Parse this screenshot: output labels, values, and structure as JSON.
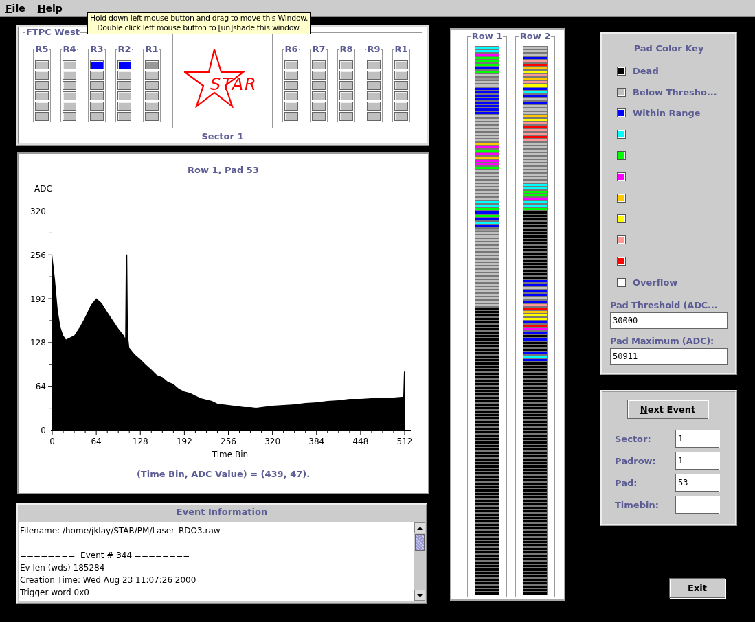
{
  "menu": [
    {
      "label": "File",
      "underline_first": true
    },
    {
      "label": "Help",
      "underline_first": true
    }
  ],
  "tooltip": {
    "lines": [
      "Hold down left mouse button and drag to move this Window.",
      "Double click left mouse button to [un]shade this window."
    ]
  },
  "sector_panel": {
    "groups": [
      {
        "title": "FTPC West",
        "rows": [
          {
            "label": "R5",
            "pads": [
              {
                "color": "#c0c0c0"
              },
              {
                "color": "#c0c0c0"
              },
              {
                "color": "#c0c0c0"
              },
              {
                "color": "#c0c0c0"
              },
              {
                "color": "#c0c0c0"
              },
              {
                "color": "#c0c0c0"
              }
            ]
          },
          {
            "label": "R4",
            "pads": [
              {
                "color": "#c0c0c0"
              },
              {
                "color": "#c0c0c0"
              },
              {
                "color": "#c0c0c0"
              },
              {
                "color": "#c0c0c0"
              },
              {
                "color": "#c0c0c0"
              },
              {
                "color": "#c0c0c0"
              }
            ]
          },
          {
            "label": "R3",
            "pads": [
              {
                "color": "#0000ff"
              },
              {
                "color": "#c0c0c0"
              },
              {
                "color": "#c0c0c0"
              },
              {
                "color": "#c0c0c0"
              },
              {
                "color": "#c0c0c0"
              },
              {
                "color": "#c0c0c0"
              }
            ]
          },
          {
            "label": "R2",
            "pads": [
              {
                "color": "#0000ff"
              },
              {
                "color": "#c0c0c0"
              },
              {
                "color": "#c0c0c0"
              },
              {
                "color": "#c0c0c0"
              },
              {
                "color": "#c0c0c0"
              },
              {
                "color": "#c0c0c0"
              }
            ]
          },
          {
            "label": "R1",
            "pads": [
              {
                "color": "#999999"
              },
              {
                "color": "#c0c0c0"
              },
              {
                "color": "#c0c0c0"
              },
              {
                "color": "#c0c0c0"
              },
              {
                "color": "#c0c0c0"
              },
              {
                "color": "#c0c0c0"
              }
            ]
          }
        ]
      },
      {
        "rows": [
          {
            "label": "R6",
            "pads": [
              {
                "color": "#c0c0c0"
              },
              {
                "color": "#c0c0c0"
              },
              {
                "color": "#c0c0c0"
              },
              {
                "color": "#c0c0c0"
              },
              {
                "color": "#c0c0c0"
              },
              {
                "color": "#c0c0c0"
              }
            ]
          },
          {
            "label": "R7",
            "pads": [
              {
                "color": "#c0c0c0"
              },
              {
                "color": "#c0c0c0"
              },
              {
                "color": "#c0c0c0"
              },
              {
                "color": "#c0c0c0"
              },
              {
                "color": "#c0c0c0"
              },
              {
                "color": "#c0c0c0"
              }
            ]
          },
          {
            "label": "R8",
            "pads": [
              {
                "color": "#c0c0c0"
              },
              {
                "color": "#c0c0c0"
              },
              {
                "color": "#c0c0c0"
              },
              {
                "color": "#c0c0c0"
              },
              {
                "color": "#c0c0c0"
              },
              {
                "color": "#c0c0c0"
              }
            ]
          },
          {
            "label": "R9",
            "pads": [
              {
                "color": "#c0c0c0"
              },
              {
                "color": "#c0c0c0"
              },
              {
                "color": "#c0c0c0"
              },
              {
                "color": "#c0c0c0"
              },
              {
                "color": "#c0c0c0"
              },
              {
                "color": "#c0c0c0"
              }
            ]
          },
          {
            "label": "R1",
            "pads": [
              {
                "color": "#c0c0c0"
              },
              {
                "color": "#c0c0c0"
              },
              {
                "color": "#c0c0c0"
              },
              {
                "color": "#c0c0c0"
              },
              {
                "color": "#c0c0c0"
              },
              {
                "color": "#c0c0c0"
              }
            ]
          }
        ]
      }
    ],
    "logo_text": "STAR",
    "sector_label": "Sector 1"
  },
  "histogram": {
    "chart_data": {
      "type": "area",
      "title": "Row 1, Pad 53",
      "xlabel": "Time Bin",
      "ylabel": "ADC",
      "xlim": [
        0,
        521
      ],
      "ylim": [
        0,
        338
      ],
      "xticks": [
        0,
        64,
        128,
        192,
        256,
        320,
        384,
        448,
        512
      ],
      "yticks": [
        0,
        64,
        128,
        192,
        256,
        320
      ],
      "x": [
        0,
        4,
        8,
        12,
        16,
        20,
        24,
        32,
        40,
        48,
        56,
        64,
        72,
        80,
        88,
        96,
        104,
        106,
        107,
        109,
        110,
        112,
        120,
        128,
        136,
        144,
        152,
        160,
        168,
        176,
        184,
        192,
        200,
        208,
        216,
        224,
        232,
        240,
        248,
        256,
        264,
        272,
        280,
        288,
        296,
        304,
        312,
        320,
        336,
        352,
        368,
        384,
        400,
        416,
        432,
        448,
        464,
        480,
        496,
        508,
        510,
        511,
        512
      ],
      "values": [
        256,
        220,
        175,
        150,
        138,
        132,
        134,
        138,
        150,
        165,
        182,
        192,
        185,
        172,
        160,
        148,
        138,
        134,
        256,
        256,
        140,
        120,
        110,
        103,
        95,
        88,
        80,
        77,
        70,
        67,
        60,
        56,
        54,
        50,
        46,
        44,
        42,
        38,
        37,
        36,
        35,
        34,
        33,
        33,
        32,
        33,
        34,
        35,
        36,
        37,
        39,
        40,
        42,
        43,
        45,
        45,
        46,
        47,
        47,
        48,
        48,
        85,
        85
      ]
    },
    "readout": "(Time Bin, ADC Value) = (439, 47)."
  },
  "event_info": {
    "title": "Event Information",
    "text": "Filename: /home/jklay/STAR/PM/Laser_RDO3.raw\n\n========  Event # 344 ========\nEv len (wds) 185284\nCreation Time: Wed Aug 23 11:07:26 2000\nTrigger word 0x0"
  },
  "pad_rows": [
    {
      "title": "Row 1",
      "pads": [
        {
          "color": "#00ffff"
        },
        {
          "color": "#00ffff"
        },
        {
          "color": "#ff00ff"
        },
        {
          "color": "#00ff00"
        },
        {
          "color": "#00ff00"
        },
        {
          "color": "#00ff00"
        },
        {
          "color": "#0000ff"
        },
        {
          "color": "#00ff00"
        },
        {
          "color": "#c0c0c0"
        },
        {
          "color": "#999999"
        },
        {
          "color": "#c0c0c0"
        },
        {
          "color": "#c0c0c0"
        },
        {
          "color": "#0000ff"
        },
        {
          "color": "#0000ff"
        },
        {
          "color": "#0000ff"
        },
        {
          "color": "#0000ff"
        },
        {
          "color": "#0000ff"
        },
        {
          "color": "#0000ff"
        },
        {
          "color": "#0000ff"
        },
        {
          "color": "#0000ff"
        },
        {
          "color": "#c0c0c0"
        },
        {
          "color": "#c0c0c0"
        },
        {
          "color": "#c0c0c0"
        },
        {
          "color": "#c0c0c0"
        },
        {
          "color": "#c0c0c0"
        },
        {
          "color": "#c0c0c0"
        },
        {
          "color": "#c0c0c0"
        },
        {
          "color": "#c0c0c0"
        },
        {
          "color": "#ffc800"
        },
        {
          "color": "#ff00ff"
        },
        {
          "color": "#00ff00"
        },
        {
          "color": "#ff00ff"
        },
        {
          "color": "#ffc800"
        },
        {
          "color": "#ff00ff"
        },
        {
          "color": "#ff00ff"
        },
        {
          "color": "#00ff00"
        },
        {
          "color": "#c0c0c0"
        },
        {
          "color": "#c0c0c0"
        },
        {
          "color": "#c0c0c0"
        },
        {
          "color": "#c0c0c0"
        },
        {
          "color": "#c0c0c0"
        },
        {
          "color": "#c0c0c0"
        },
        {
          "color": "#c0c0c0"
        },
        {
          "color": "#c0c0c0"
        },
        {
          "color": "#c0c0c0"
        },
        {
          "color": "#00ffff"
        },
        {
          "color": "#00ffff"
        },
        {
          "color": "#00ff00"
        },
        {
          "color": "#0000ff"
        },
        {
          "color": "#00ff00"
        },
        {
          "color": "#0000ff"
        },
        {
          "color": "#00ffff"
        },
        {
          "color": "#0000ff"
        },
        {
          "color": "#999999"
        },
        {
          "color": "#c0c0c0"
        },
        {
          "color": "#c0c0c0"
        },
        {
          "color": "#c0c0c0"
        },
        {
          "color": "#c0c0c0"
        },
        {
          "color": "#c0c0c0"
        },
        {
          "color": "#c0c0c0"
        },
        {
          "color": "#c0c0c0"
        },
        {
          "color": "#c0c0c0"
        },
        {
          "color": "#c0c0c0"
        },
        {
          "color": "#c0c0c0"
        },
        {
          "color": "#c0c0c0"
        },
        {
          "color": "#c0c0c0"
        },
        {
          "color": "#c0c0c0"
        },
        {
          "color": "#c0c0c0"
        },
        {
          "color": "#c0c0c0"
        },
        {
          "color": "#c0c0c0"
        },
        {
          "color": "#c0c0c0"
        },
        {
          "color": "#c0c0c0"
        },
        {
          "color": "#c0c0c0"
        },
        {
          "color": "#c0c0c0"
        },
        {
          "color": "#c0c0c0"
        },
        {
          "color": "#c0c0c0"
        },
        {
          "color": "#000000"
        },
        {
          "color": "#000000"
        },
        {
          "color": "#000000"
        },
        {
          "color": "#000000"
        },
        {
          "color": "#000000"
        },
        {
          "color": "#000000"
        },
        {
          "color": "#000000"
        },
        {
          "color": "#000000"
        },
        {
          "color": "#000000"
        },
        {
          "color": "#000000"
        },
        {
          "color": "#000000"
        },
        {
          "color": "#000000"
        },
        {
          "color": "#000000"
        },
        {
          "color": "#000000"
        },
        {
          "color": "#000000"
        },
        {
          "color": "#000000"
        },
        {
          "color": "#000000"
        },
        {
          "color": "#000000"
        },
        {
          "color": "#000000"
        },
        {
          "color": "#000000"
        },
        {
          "color": "#000000"
        },
        {
          "color": "#000000"
        },
        {
          "color": "#000000"
        },
        {
          "color": "#000000"
        },
        {
          "color": "#000000"
        },
        {
          "color": "#000000"
        },
        {
          "color": "#000000"
        },
        {
          "color": "#000000"
        },
        {
          "color": "#000000"
        },
        {
          "color": "#000000"
        },
        {
          "color": "#000000"
        },
        {
          "color": "#000000"
        },
        {
          "color": "#000000"
        },
        {
          "color": "#000000"
        },
        {
          "color": "#000000"
        },
        {
          "color": "#000000"
        },
        {
          "color": "#000000"
        },
        {
          "color": "#000000"
        },
        {
          "color": "#000000"
        },
        {
          "color": "#000000"
        },
        {
          "color": "#000000"
        },
        {
          "color": "#000000"
        },
        {
          "color": "#000000"
        },
        {
          "color": "#000000"
        },
        {
          "color": "#000000"
        },
        {
          "color": "#000000"
        },
        {
          "color": "#000000"
        },
        {
          "color": "#000000"
        },
        {
          "color": "#000000"
        },
        {
          "color": "#000000"
        },
        {
          "color": "#000000"
        },
        {
          "color": "#000000"
        },
        {
          "color": "#000000"
        },
        {
          "color": "#000000"
        },
        {
          "color": "#000000"
        },
        {
          "color": "#000000"
        },
        {
          "color": "#000000"
        },
        {
          "color": "#000000"
        },
        {
          "color": "#000000"
        },
        {
          "color": "#000000"
        },
        {
          "color": "#000000"
        },
        {
          "color": "#000000"
        },
        {
          "color": "#000000"
        },
        {
          "color": "#000000"
        },
        {
          "color": "#000000"
        },
        {
          "color": "#000000"
        },
        {
          "color": "#000000"
        },
        {
          "color": "#000000"
        },
        {
          "color": "#000000"
        },
        {
          "color": "#000000"
        },
        {
          "color": "#000000"
        },
        {
          "color": "#000000"
        },
        {
          "color": "#000000"
        },
        {
          "color": "#000000"
        },
        {
          "color": "#000000"
        },
        {
          "color": "#000000"
        },
        {
          "color": "#000000"
        },
        {
          "color": "#000000"
        },
        {
          "color": "#000000"
        },
        {
          "color": "#000000"
        },
        {
          "color": "#000000"
        },
        {
          "color": "#000000"
        },
        {
          "color": "#000000"
        },
        {
          "color": "#000000"
        }
      ]
    },
    {
      "title": "Row 2",
      "pads": [
        {
          "color": "#c0c0c0"
        },
        {
          "color": "#c0c0c0"
        },
        {
          "color": "#c0c0c0"
        },
        {
          "color": "#0000ff"
        },
        {
          "color": "#ff9999"
        },
        {
          "color": "#ff0000"
        },
        {
          "color": "#ffc800"
        },
        {
          "color": "#ffff00"
        },
        {
          "color": "#ff9999"
        },
        {
          "color": "#ffc800"
        },
        {
          "color": "#ff9999"
        },
        {
          "color": "#ffff00"
        },
        {
          "color": "#0000ff"
        },
        {
          "color": "#00ffff"
        },
        {
          "color": "#0000ff"
        },
        {
          "color": "#c0c0c0"
        },
        {
          "color": "#0000ff"
        },
        {
          "color": "#c0c0c0"
        },
        {
          "color": "#c0c0c0"
        },
        {
          "color": "#c0c0c0"
        },
        {
          "color": "#ffc800"
        },
        {
          "color": "#ffff00"
        },
        {
          "color": "#ff9999"
        },
        {
          "color": "#ff0000"
        },
        {
          "color": "#ff9999"
        },
        {
          "color": "#ff9999"
        },
        {
          "color": "#ff0000"
        },
        {
          "color": "#ff9999"
        },
        {
          "color": "#c0c0c0"
        },
        {
          "color": "#c0c0c0"
        },
        {
          "color": "#c0c0c0"
        },
        {
          "color": "#c0c0c0"
        },
        {
          "color": "#c0c0c0"
        },
        {
          "color": "#c0c0c0"
        },
        {
          "color": "#c0c0c0"
        },
        {
          "color": "#c0c0c0"
        },
        {
          "color": "#c0c0c0"
        },
        {
          "color": "#c0c0c0"
        },
        {
          "color": "#c0c0c0"
        },
        {
          "color": "#c0c0c0"
        },
        {
          "color": "#00ffff"
        },
        {
          "color": "#00ffff"
        },
        {
          "color": "#00ff00"
        },
        {
          "color": "#00ff00"
        },
        {
          "color": "#ff00ff"
        },
        {
          "color": "#00ffff"
        },
        {
          "color": "#00ffff"
        },
        {
          "color": "#00ff00"
        },
        {
          "color": "#000000"
        },
        {
          "color": "#000000"
        },
        {
          "color": "#000000"
        },
        {
          "color": "#000000"
        },
        {
          "color": "#000000"
        },
        {
          "color": "#000000"
        },
        {
          "color": "#000000"
        },
        {
          "color": "#000000"
        },
        {
          "color": "#000000"
        },
        {
          "color": "#000000"
        },
        {
          "color": "#000000"
        },
        {
          "color": "#000000"
        },
        {
          "color": "#000000"
        },
        {
          "color": "#000000"
        },
        {
          "color": "#000000"
        },
        {
          "color": "#000000"
        },
        {
          "color": "#000000"
        },
        {
          "color": "#000000"
        },
        {
          "color": "#000000"
        },
        {
          "color": "#000000"
        },
        {
          "color": "#0000ff"
        },
        {
          "color": "#0000ff"
        },
        {
          "color": "#c0c0c0"
        },
        {
          "color": "#0000ff"
        },
        {
          "color": "#0000ff"
        },
        {
          "color": "#c0c0c0"
        },
        {
          "color": "#0000ff"
        },
        {
          "color": "#ff9999"
        },
        {
          "color": "#ff0000"
        },
        {
          "color": "#ffc800"
        },
        {
          "color": "#ffff00"
        },
        {
          "color": "#ffff00"
        },
        {
          "color": "#0000ff"
        },
        {
          "color": "#ff0000"
        },
        {
          "color": "#ff00ff"
        },
        {
          "color": "#0000ff"
        },
        {
          "color": "#000000"
        },
        {
          "color": "#0000ff"
        },
        {
          "color": "#000000"
        },
        {
          "color": "#000000"
        },
        {
          "color": "#000000"
        },
        {
          "color": "#0000ff"
        },
        {
          "color": "#00ffff"
        },
        {
          "color": "#0000ff"
        },
        {
          "color": "#000000"
        },
        {
          "color": "#000000"
        },
        {
          "color": "#000000"
        },
        {
          "color": "#000000"
        },
        {
          "color": "#000000"
        },
        {
          "color": "#000000"
        },
        {
          "color": "#000000"
        },
        {
          "color": "#000000"
        },
        {
          "color": "#000000"
        },
        {
          "color": "#000000"
        },
        {
          "color": "#000000"
        },
        {
          "color": "#000000"
        },
        {
          "color": "#000000"
        },
        {
          "color": "#000000"
        },
        {
          "color": "#000000"
        },
        {
          "color": "#000000"
        },
        {
          "color": "#000000"
        },
        {
          "color": "#000000"
        },
        {
          "color": "#000000"
        },
        {
          "color": "#000000"
        },
        {
          "color": "#000000"
        },
        {
          "color": "#000000"
        },
        {
          "color": "#000000"
        },
        {
          "color": "#000000"
        },
        {
          "color": "#000000"
        },
        {
          "color": "#000000"
        },
        {
          "color": "#000000"
        },
        {
          "color": "#000000"
        },
        {
          "color": "#000000"
        },
        {
          "color": "#000000"
        },
        {
          "color": "#000000"
        },
        {
          "color": "#000000"
        },
        {
          "color": "#000000"
        },
        {
          "color": "#000000"
        },
        {
          "color": "#000000"
        },
        {
          "color": "#000000"
        },
        {
          "color": "#000000"
        },
        {
          "color": "#000000"
        },
        {
          "color": "#000000"
        },
        {
          "color": "#000000"
        },
        {
          "color": "#000000"
        },
        {
          "color": "#000000"
        },
        {
          "color": "#000000"
        },
        {
          "color": "#000000"
        },
        {
          "color": "#000000"
        },
        {
          "color": "#000000"
        },
        {
          "color": "#000000"
        },
        {
          "color": "#000000"
        },
        {
          "color": "#000000"
        },
        {
          "color": "#000000"
        },
        {
          "color": "#000000"
        },
        {
          "color": "#000000"
        },
        {
          "color": "#000000"
        },
        {
          "color": "#000000"
        },
        {
          "color": "#000000"
        },
        {
          "color": "#000000"
        },
        {
          "color": "#000000"
        },
        {
          "color": "#000000"
        },
        {
          "color": "#000000"
        },
        {
          "color": "#000000"
        },
        {
          "color": "#000000"
        },
        {
          "color": "#000000"
        },
        {
          "color": "#000000"
        },
        {
          "color": "#000000"
        },
        {
          "color": "#000000"
        },
        {
          "color": "#000000"
        },
        {
          "color": "#000000"
        },
        {
          "color": "#000000"
        }
      ]
    }
  ],
  "color_key": {
    "title": "Pad Color Key",
    "items": [
      {
        "color": "#000000",
        "label": "Dead"
      },
      {
        "color": "#c0c0c0",
        "label": "Below Thresho..."
      },
      {
        "color": "#0000ff",
        "label": "Within Range"
      },
      {
        "color": "#00ffff"
      },
      {
        "color": "#00ff00"
      },
      {
        "color": "#ff00ff"
      },
      {
        "color": "#ffc800"
      },
      {
        "color": "#ffff00"
      },
      {
        "color": "#ff9999"
      },
      {
        "color": "#ff0000"
      },
      {
        "color": "#ffffff",
        "label": "Overflow"
      }
    ],
    "fields": [
      {
        "label": "Pad Threshold (ADC...",
        "value": "30000"
      },
      {
        "label": "Pad Maximum (ADC):",
        "value": "50911"
      }
    ]
  },
  "controls": {
    "button": {
      "label": "Next Event",
      "underline_first": true
    },
    "fields": [
      {
        "label": "Sector:",
        "value": "1"
      },
      {
        "label": "Padrow:",
        "value": "1"
      },
      {
        "label": "Pad:",
        "value": "53"
      },
      {
        "label": "Timebin:"
      }
    ]
  },
  "exit_button": {
    "label": "Exit",
    "underline_first": true
  }
}
